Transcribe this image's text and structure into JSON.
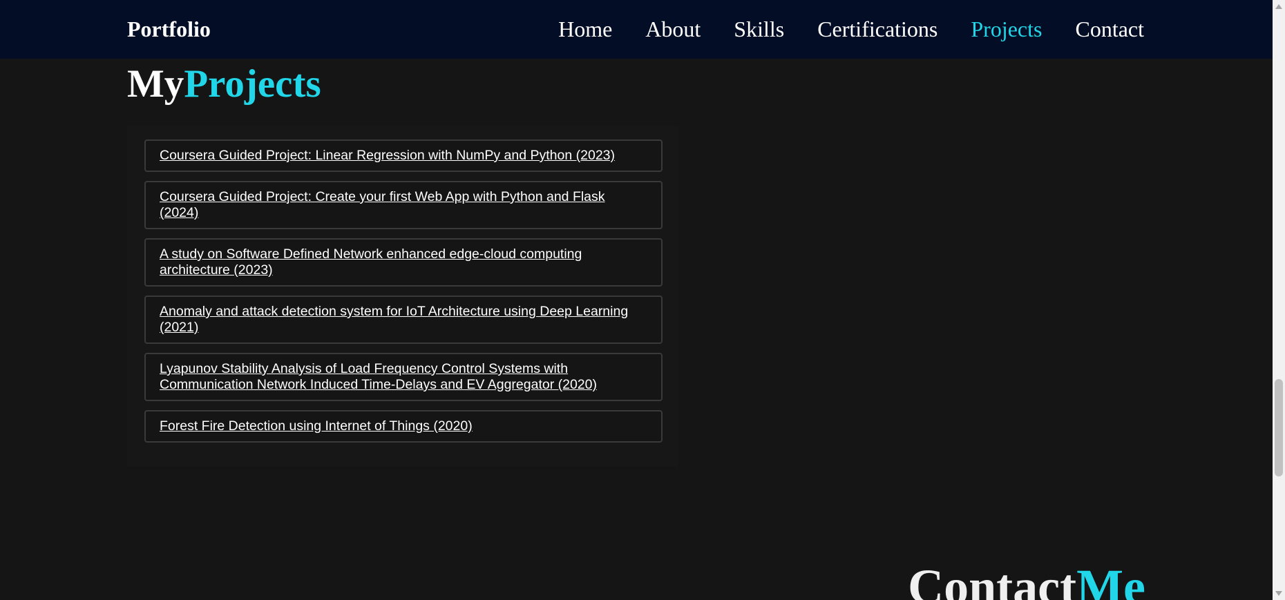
{
  "navbar": {
    "brand": "Portfolio",
    "links": [
      {
        "label": "Home"
      },
      {
        "label": "About"
      },
      {
        "label": "Skills"
      },
      {
        "label": "Certifications"
      },
      {
        "label": "Projects",
        "active": true
      },
      {
        "label": "Contact"
      }
    ]
  },
  "projects_section": {
    "title_prefix": "My",
    "title_accent": "Projects",
    "items": [
      {
        "title": "Coursera Guided Project: Linear Regression with NumPy and Python (2023)"
      },
      {
        "title": "Coursera Guided Project: Create your first Web App with Python and Flask (2024)"
      },
      {
        "title": "A study on Software Defined Network enhanced edge-cloud computing architecture (2023)"
      },
      {
        "title": "Anomaly and attack detection system for IoT Architecture using Deep Learning (2021)"
      },
      {
        "title": "Lyapunov Stability Analysis of Load Frequency Control Systems with Communication Network Induced Time-Delays and EV Aggregator (2020)"
      },
      {
        "title": "Forest Fire Detection using Internet of Things (2020)"
      }
    ]
  },
  "contact_section": {
    "title_prefix": "Contact",
    "title_accent": "Me"
  },
  "colors": {
    "navbar_bg": "#030d26",
    "page_bg": "#151515",
    "accent": "#21d6e8",
    "text": "#ffffff",
    "item_border": "#3a3a3a"
  },
  "icons": {
    "scroll_up": "scroll-up-arrow-icon",
    "scroll_down": "scroll-down-arrow-icon"
  }
}
